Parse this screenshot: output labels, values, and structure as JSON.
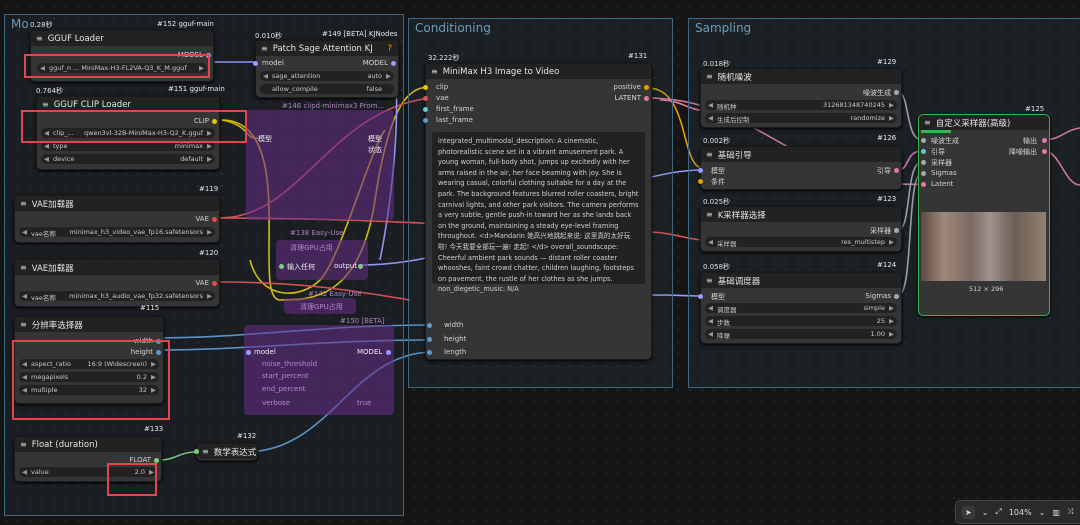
{
  "groups": [
    {
      "title": "Mo"
    },
    {
      "title": "Conditioning"
    },
    {
      "title": "Sampling"
    }
  ],
  "nodes": {
    "gguf_loader": {
      "time": "0.28秒",
      "id": "#152 gguf-main",
      "title": "GGUF Loader",
      "output": "MODEL",
      "widget_value": "gguf_n ... MiniMax-H3-FL2VA-Q3_K_M.gguf"
    },
    "patch_sage": {
      "time": "0.010秒",
      "id": "#149 [BETA] KJNodes",
      "title": "Patch Sage Attention KJ",
      "in_model": "model",
      "out_model": "MODEL",
      "w1_label": "sage_attention",
      "w1_value": "auto",
      "w2_label": "allow_compile",
      "w2_value": "false"
    },
    "gguf_clip": {
      "time": "0.764秒",
      "id": "#151 gguf-main",
      "title": "GGUF CLIP Loader",
      "output": "CLIP",
      "w1_label": "clip_...",
      "w1_value": "qwen3vl-32B-MiniMax-H3-Q2_K.gguf",
      "w2_label": "type",
      "w2_value": "minimax",
      "w3_label": "device",
      "w3_value": "default"
    },
    "vae_video": {
      "id": "#119",
      "title": "VAE加载器",
      "output": "VAE",
      "w_label": "vae名称",
      "w_value": "minimax_h3_video_vae_fp16.safetensors"
    },
    "vae_audio": {
      "id": "#120",
      "title": "VAE加载器",
      "output": "VAE",
      "w_label": "vae名称",
      "w_value": "minimax_h3_audio_vae_fp32.safetensors"
    },
    "resolution": {
      "id": "#115",
      "title": "分辨率选择器",
      "out_width": "width",
      "out_height": "height",
      "w1_label": "aspect_ratio",
      "w1_value": "16:9 (Widescreen)",
      "w2_label": "megapixels",
      "w2_value": "0.2",
      "w3_label": "multiple",
      "w3_value": "32"
    },
    "float_duration": {
      "id": "#133",
      "title": "Float (duration)",
      "output": "FLOAT",
      "w_label": "value",
      "w_value": "2.0"
    },
    "math_expr": {
      "id": "#132",
      "title": "数学表达式"
    },
    "minimax_i2v": {
      "time": "32.222秒",
      "id": "#131",
      "title": "MiniMax H3 Image to Video",
      "inputs": [
        "clip",
        "vae",
        "first_frame",
        "last_frame"
      ],
      "outputs": [
        "positive",
        "LATENT"
      ],
      "prompt": "integrated_multimodal_description: A cinematic, photorealistic scene set in a vibrant amusement park. A young woman, full-body shot, jumps up excitedly with her arms raised in the air, her face beaming with joy. She is wearing casual, colorful clothing suitable for a day at the park. The background features blurred roller coasters, bright carnival lights, and other park visitors. The camera performs a very subtle, gentle push-in toward her as she lands back on the ground, maintaining a steady eye-level framing throughout. <d>Mandarin 她高兴地跳起来说: 这里真的太好玩啦! 今天我要全部玩一遍! 走起! </d> overall_soundscape: Cheerful ambient park sounds — distant roller coaster whooshes, faint crowd chatter, children laughing, footsteps on pavement, the rustle of her clothes as she jumps. non_diegetic_music: N/A",
      "extra_inputs": [
        "width",
        "height",
        "length"
      ]
    },
    "random_noise": {
      "time": "0.018秒",
      "id": "#129",
      "title": "随机噪波",
      "output": "噪波生成",
      "w1_label": "随机种",
      "w1_value": "312681348740245",
      "w2_label": "生成后控制",
      "w2_value": "randomize"
    },
    "basic_guider": {
      "time": "0.002秒",
      "id": "#126",
      "title": "基础引导",
      "in1": "模型",
      "in2": "条件",
      "output": "引导"
    },
    "ksampler_select": {
      "time": "0.025秒",
      "id": "#123",
      "title": "K采样器选择",
      "output": "采样器",
      "w_label": "采样器",
      "w_value": "res_multistep"
    },
    "basic_scheduler": {
      "time": "0.058秒",
      "id": "#124",
      "title": "基础调度器",
      "in1": "模型",
      "output": "Sigmas",
      "w1_label": "调度器",
      "w1_value": "simple",
      "w2_label": "步数",
      "w2_value": "25",
      "w3_label": "降噪",
      "w3_value": "1.00"
    },
    "custom_sampler": {
      "id": "#125",
      "title": "自定义采样器(高级)",
      "inputs": [
        "噪波生成",
        "引导",
        "采样器",
        "Sigmas",
        "Latent"
      ],
      "outputs": [
        "输出",
        "降噪输出"
      ],
      "size": "512 × 296"
    }
  },
  "bypassed": {
    "clip_node_title": "#146 clipd-minimax3 Prom...",
    "clip_node_in": "模型",
    "clip_node_out1": "模型",
    "clip_node_out2": "状态",
    "clear_vram_title": "清理GPU占用",
    "clear_vram_id": "#138 Easy-Use",
    "clear_vram_in": "输入任何",
    "clear_vram_out": "output",
    "clear2_title": "清理GPU占用",
    "clear2_id": "#142 Easy-Use",
    "lora_id": "#150 [BETA]",
    "lora_in": "model",
    "lora_out": "MODEL",
    "lora_w1": "noise_threshold",
    "lora_w2": "start_percent",
    "lora_w3": "end_percent",
    "lora_w4": "verbose",
    "lora_w4_val": "true"
  },
  "toolbar": {
    "zoom": "104%"
  },
  "colors": {
    "highlight": "#e0464a",
    "group_border": "#3f6680",
    "link_yellow": "#e5c400",
    "link_pink": "#e07aa0",
    "link_red": "#e05050"
  }
}
